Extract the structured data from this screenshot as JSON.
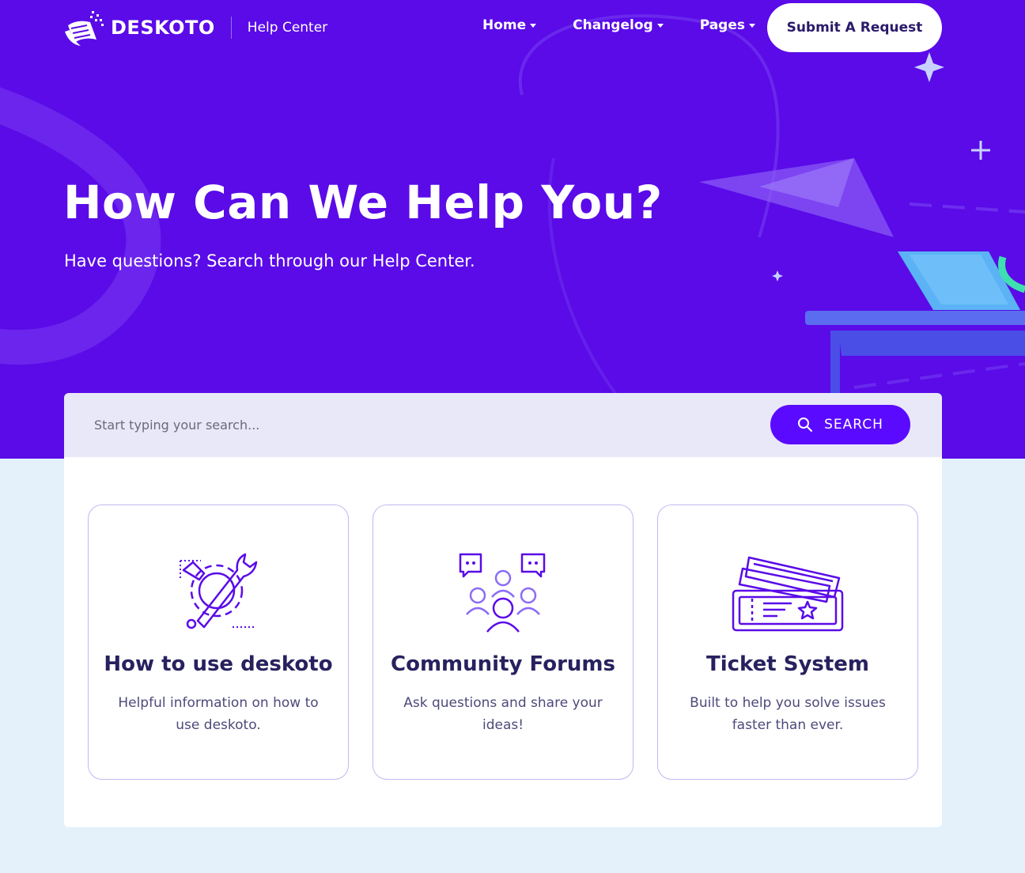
{
  "brand": {
    "name": "DESKOTO",
    "subtitle": "Help Center"
  },
  "nav": {
    "items": [
      {
        "label": "Home"
      },
      {
        "label": "Changelog"
      },
      {
        "label": "Pages"
      }
    ],
    "cta_label": "Submit A Request"
  },
  "hero": {
    "title": "How Can We Help You?",
    "subtitle": "Have questions? Search through our Help Center."
  },
  "search": {
    "placeholder": "Start typing your search...",
    "button_label": "SEARCH"
  },
  "cards": [
    {
      "icon": "wrench-gear-icon",
      "title": "How to use deskoto",
      "desc": "Helpful information on how to use deskoto."
    },
    {
      "icon": "community-people-icon",
      "title": "Community Forums",
      "desc": "Ask questions and share your ideas!"
    },
    {
      "icon": "ticket-icon",
      "title": "Ticket System",
      "desc": "Built to help you solve issues faster than ever."
    }
  ],
  "colors": {
    "primary": "#5a0be8",
    "accent": "#5a0bff",
    "page_bg": "#e4f0fa",
    "heading": "#27215f"
  }
}
